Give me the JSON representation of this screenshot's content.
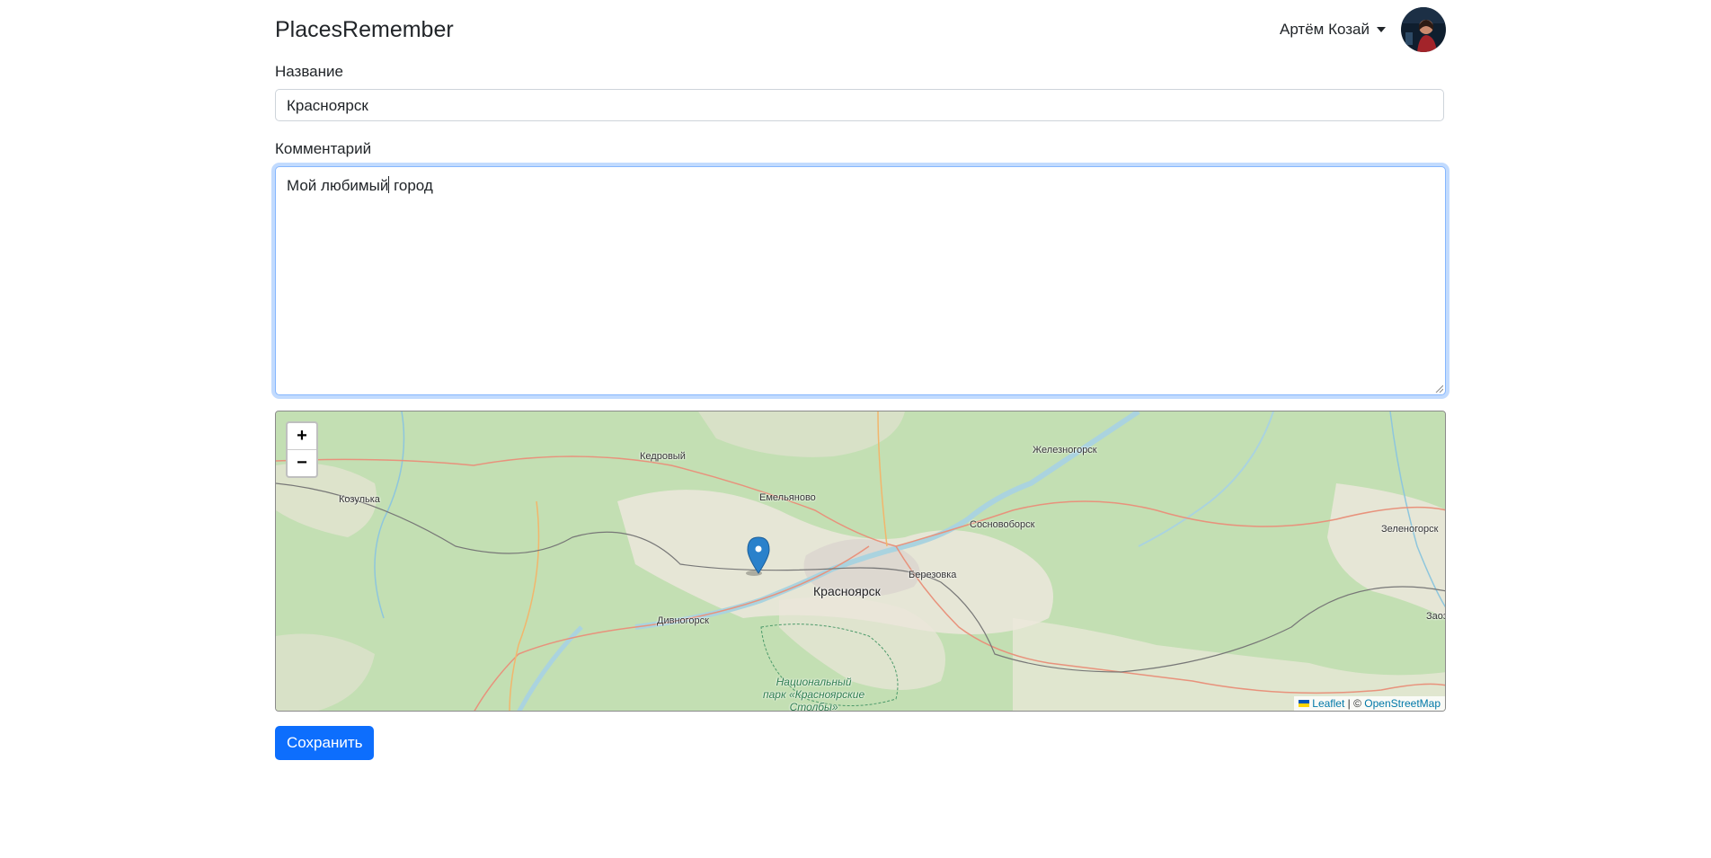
{
  "navbar": {
    "brand": "PlacesRemember",
    "user_name": "Артём Козай"
  },
  "form": {
    "name_label": "Название",
    "name_value": "Красноярск",
    "comment_label": "Комментарий",
    "comment_before_cursor": "Мой любимый",
    "comment_after_cursor": " город",
    "save_label": "Сохранить"
  },
  "map": {
    "zoom_in": "+",
    "zoom_out": "−",
    "places": {
      "kedrovy": "Кедровый",
      "zheleznogorsk": "Железногорск",
      "kozulka": "Козулька",
      "emelyanovo": "Емельяново",
      "sosnovoborsk": "Сосновоборск",
      "zelenogorsk": "Зеленогорск",
      "berezovka": "Березовка",
      "krasnoyarsk": "Красноярск",
      "divnogorsk": "Дивногорск",
      "zaozerny": "Заоз",
      "park_line1": "Национальный",
      "park_line2": "парк «Красноярские",
      "park_line3": "Столбы»"
    },
    "attribution": {
      "leaflet": "Leaflet",
      "separator": " | © ",
      "osm": "OpenStreetMap"
    }
  },
  "colors": {
    "primary": "#0d6efd",
    "map_forest": "#c3dfb3",
    "map_land": "#f1eee6",
    "map_water": "#aad3df",
    "marker": "#2a81cb"
  }
}
